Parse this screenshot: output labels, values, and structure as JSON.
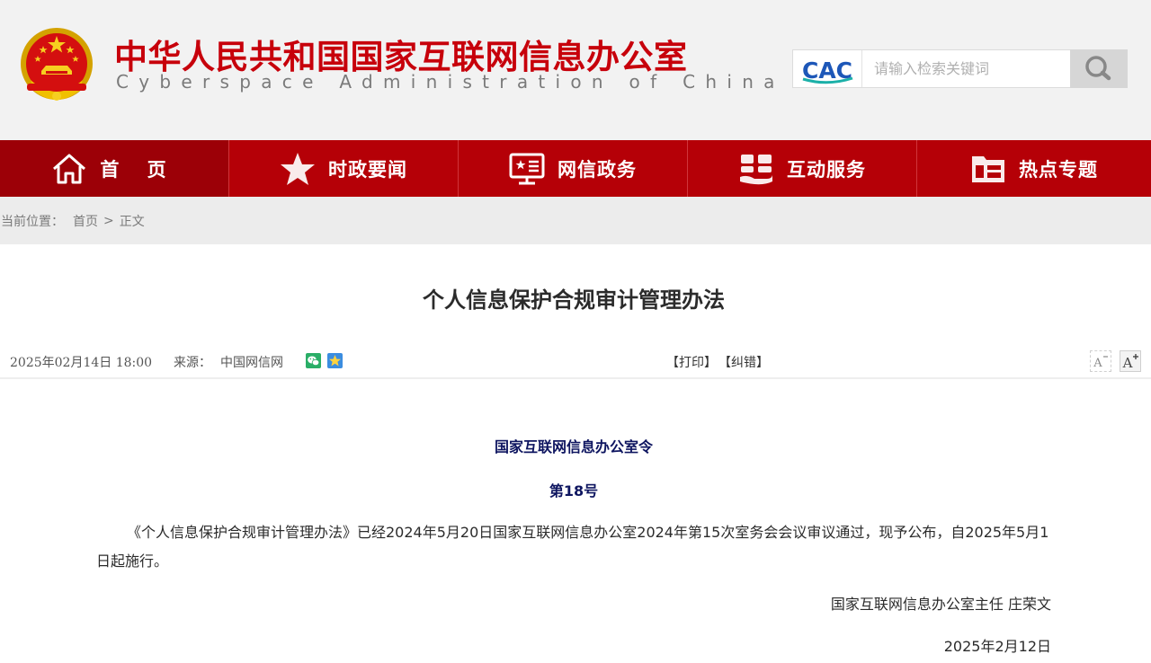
{
  "header": {
    "title_cn": "中华人民共和国国家互联网信息办公室",
    "title_en": "Cyberspace Administration of China",
    "logo_text": "CAC",
    "search_placeholder": "请输入检索关键词"
  },
  "nav": {
    "items": [
      {
        "label": "首 页",
        "icon": "home-icon"
      },
      {
        "label": "时政要闻",
        "icon": "star-icon"
      },
      {
        "label": "网信政务",
        "icon": "monitor-icon"
      },
      {
        "label": "互动服务",
        "icon": "interaction-icon"
      },
      {
        "label": "热点专题",
        "icon": "folder-icon"
      }
    ]
  },
  "breadcrumb": {
    "prefix": "当前位置：",
    "home": "首页",
    "separator": ">",
    "current": "正文"
  },
  "article": {
    "title": "个人信息保护合规审计管理办法",
    "date": "2025年02月14日 18:00",
    "source_label": "来源：",
    "source": "中国网信网",
    "print_label": "【打印】",
    "correct_label": "【纠错】",
    "font_decrease": "A",
    "font_increase": "A",
    "order_issuer": "国家互联网信息办公室令",
    "order_number": "第18号",
    "paragraph": "《个人信息保护合规审计管理办法》已经2024年5月20日国家互联网信息办公室2024年第15次室务会会议审议通过，现予公布，自2025年5月1日起施行。",
    "signature": "国家互联网信息办公室主任 庄荣文",
    "sign_date": "2025年2月12日"
  },
  "colors": {
    "brand_red": "#c7000b",
    "nav_bg": "#b50007",
    "nav_active": "#9c0007",
    "order_blue": "#0e1560"
  }
}
